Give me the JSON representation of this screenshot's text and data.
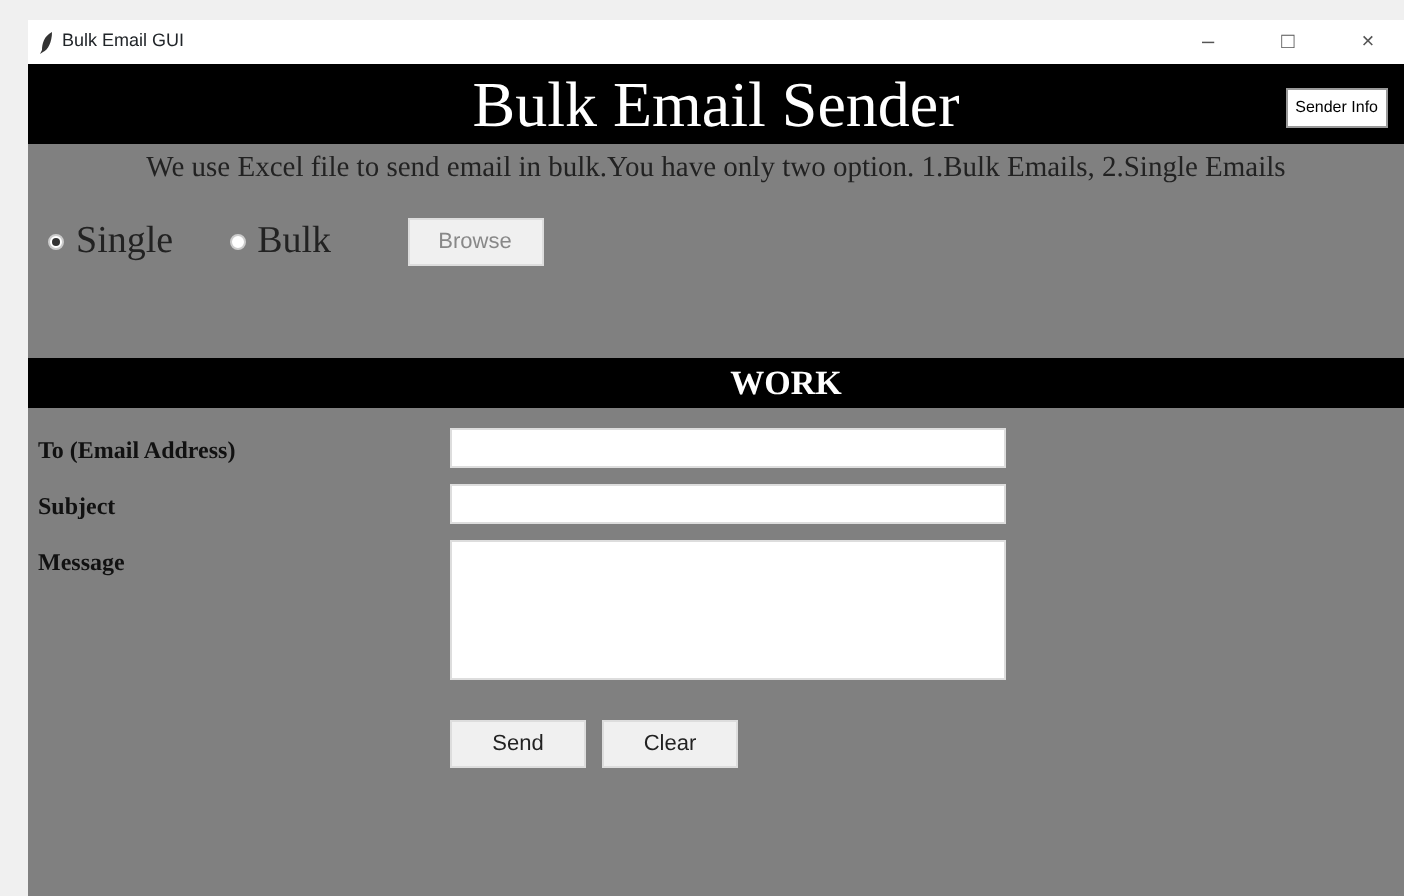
{
  "window": {
    "title": "Bulk Email GUI",
    "controls": [
      "–",
      "□",
      "×"
    ]
  },
  "header": {
    "title": "Bulk Email Sender",
    "button": "Sender Info"
  },
  "description": "We use Excel file to send email in bulk.You have only two option. 1.Bulk Emails, 2.Single Emails",
  "modes": [
    {
      "label": "Single",
      "selected": true
    },
    {
      "label": "Bulk",
      "selected": false
    }
  ],
  "browse_button": {
    "label": "Browse",
    "disabled": true
  },
  "section_title": "WORK",
  "fields": [
    {
      "label": "To (Email Address)",
      "kind": "line"
    },
    {
      "label": "Subject",
      "kind": "line"
    },
    {
      "label": "Message",
      "kind": "area"
    }
  ],
  "buttons": [
    "Send",
    "Clear"
  ]
}
